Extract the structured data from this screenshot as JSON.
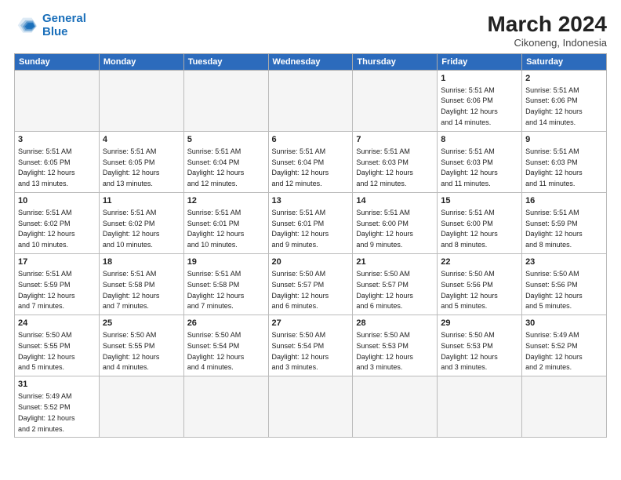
{
  "header": {
    "logo_line1": "General",
    "logo_line2": "Blue",
    "month_title": "March 2024",
    "subtitle": "Cikoneng, Indonesia"
  },
  "weekdays": [
    "Sunday",
    "Monday",
    "Tuesday",
    "Wednesday",
    "Thursday",
    "Friday",
    "Saturday"
  ],
  "weeks": [
    [
      {
        "day": "",
        "empty": true
      },
      {
        "day": "",
        "empty": true
      },
      {
        "day": "",
        "empty": true
      },
      {
        "day": "",
        "empty": true
      },
      {
        "day": "",
        "empty": true
      },
      {
        "day": "1",
        "sunrise": "5:51 AM",
        "sunset": "6:06 PM",
        "daylight": "12 hours and 14 minutes."
      },
      {
        "day": "2",
        "sunrise": "5:51 AM",
        "sunset": "6:06 PM",
        "daylight": "12 hours and 14 minutes."
      }
    ],
    [
      {
        "day": "3",
        "sunrise": "5:51 AM",
        "sunset": "6:05 PM",
        "daylight": "12 hours and 13 minutes."
      },
      {
        "day": "4",
        "sunrise": "5:51 AM",
        "sunset": "6:05 PM",
        "daylight": "12 hours and 13 minutes."
      },
      {
        "day": "5",
        "sunrise": "5:51 AM",
        "sunset": "6:04 PM",
        "daylight": "12 hours and 12 minutes."
      },
      {
        "day": "6",
        "sunrise": "5:51 AM",
        "sunset": "6:04 PM",
        "daylight": "12 hours and 12 minutes."
      },
      {
        "day": "7",
        "sunrise": "5:51 AM",
        "sunset": "6:03 PM",
        "daylight": "12 hours and 12 minutes."
      },
      {
        "day": "8",
        "sunrise": "5:51 AM",
        "sunset": "6:03 PM",
        "daylight": "12 hours and 11 minutes."
      },
      {
        "day": "9",
        "sunrise": "5:51 AM",
        "sunset": "6:03 PM",
        "daylight": "12 hours and 11 minutes."
      }
    ],
    [
      {
        "day": "10",
        "sunrise": "5:51 AM",
        "sunset": "6:02 PM",
        "daylight": "12 hours and 10 minutes."
      },
      {
        "day": "11",
        "sunrise": "5:51 AM",
        "sunset": "6:02 PM",
        "daylight": "12 hours and 10 minutes."
      },
      {
        "day": "12",
        "sunrise": "5:51 AM",
        "sunset": "6:01 PM",
        "daylight": "12 hours and 10 minutes."
      },
      {
        "day": "13",
        "sunrise": "5:51 AM",
        "sunset": "6:01 PM",
        "daylight": "12 hours and 9 minutes."
      },
      {
        "day": "14",
        "sunrise": "5:51 AM",
        "sunset": "6:00 PM",
        "daylight": "12 hours and 9 minutes."
      },
      {
        "day": "15",
        "sunrise": "5:51 AM",
        "sunset": "6:00 PM",
        "daylight": "12 hours and 8 minutes."
      },
      {
        "day": "16",
        "sunrise": "5:51 AM",
        "sunset": "5:59 PM",
        "daylight": "12 hours and 8 minutes."
      }
    ],
    [
      {
        "day": "17",
        "sunrise": "5:51 AM",
        "sunset": "5:59 PM",
        "daylight": "12 hours and 7 minutes."
      },
      {
        "day": "18",
        "sunrise": "5:51 AM",
        "sunset": "5:58 PM",
        "daylight": "12 hours and 7 minutes."
      },
      {
        "day": "19",
        "sunrise": "5:51 AM",
        "sunset": "5:58 PM",
        "daylight": "12 hours and 7 minutes."
      },
      {
        "day": "20",
        "sunrise": "5:50 AM",
        "sunset": "5:57 PM",
        "daylight": "12 hours and 6 minutes."
      },
      {
        "day": "21",
        "sunrise": "5:50 AM",
        "sunset": "5:57 PM",
        "daylight": "12 hours and 6 minutes."
      },
      {
        "day": "22",
        "sunrise": "5:50 AM",
        "sunset": "5:56 PM",
        "daylight": "12 hours and 5 minutes."
      },
      {
        "day": "23",
        "sunrise": "5:50 AM",
        "sunset": "5:56 PM",
        "daylight": "12 hours and 5 minutes."
      }
    ],
    [
      {
        "day": "24",
        "sunrise": "5:50 AM",
        "sunset": "5:55 PM",
        "daylight": "12 hours and 5 minutes."
      },
      {
        "day": "25",
        "sunrise": "5:50 AM",
        "sunset": "5:55 PM",
        "daylight": "12 hours and 4 minutes."
      },
      {
        "day": "26",
        "sunrise": "5:50 AM",
        "sunset": "5:54 PM",
        "daylight": "12 hours and 4 minutes."
      },
      {
        "day": "27",
        "sunrise": "5:50 AM",
        "sunset": "5:54 PM",
        "daylight": "12 hours and 3 minutes."
      },
      {
        "day": "28",
        "sunrise": "5:50 AM",
        "sunset": "5:53 PM",
        "daylight": "12 hours and 3 minutes."
      },
      {
        "day": "29",
        "sunrise": "5:50 AM",
        "sunset": "5:53 PM",
        "daylight": "12 hours and 3 minutes."
      },
      {
        "day": "30",
        "sunrise": "5:49 AM",
        "sunset": "5:52 PM",
        "daylight": "12 hours and 2 minutes."
      }
    ],
    [
      {
        "day": "31",
        "sunrise": "5:49 AM",
        "sunset": "5:52 PM",
        "daylight": "12 hours and 2 minutes."
      },
      {
        "day": "",
        "empty": true
      },
      {
        "day": "",
        "empty": true
      },
      {
        "day": "",
        "empty": true
      },
      {
        "day": "",
        "empty": true
      },
      {
        "day": "",
        "empty": true
      },
      {
        "day": "",
        "empty": true
      }
    ]
  ]
}
